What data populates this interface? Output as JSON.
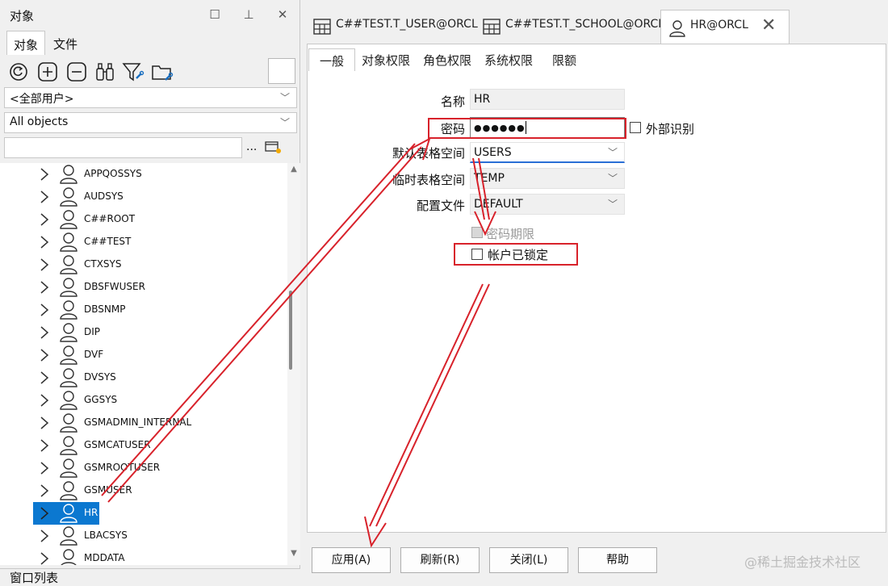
{
  "left_panel": {
    "title": "对象",
    "subtabs": [
      "对象",
      "文件"
    ],
    "user_filter": "<全部用户>",
    "object_filter": "All objects",
    "search": {
      "value": "",
      "options_label": "..."
    },
    "tree": [
      {
        "label": "APPQOSSYS"
      },
      {
        "label": "AUDSYS"
      },
      {
        "label": "C##ROOT"
      },
      {
        "label": "C##TEST"
      },
      {
        "label": "CTXSYS"
      },
      {
        "label": "DBSFWUSER"
      },
      {
        "label": "DBSNMP"
      },
      {
        "label": "DIP"
      },
      {
        "label": "DVF"
      },
      {
        "label": "DVSYS"
      },
      {
        "label": "GGSYS"
      },
      {
        "label": "GSMADMIN_INTERNAL"
      },
      {
        "label": "GSMCATUSER"
      },
      {
        "label": "GSMROOTUSER"
      },
      {
        "label": "GSMUSER"
      },
      {
        "label": "HR",
        "selected": true
      },
      {
        "label": "LBACSYS"
      },
      {
        "label": "MDDATA"
      }
    ],
    "bottom_panel_title": "窗口列表"
  },
  "doc_tabs": [
    {
      "label": "C##TEST.T_USER@ORCL",
      "icon": "table-icon"
    },
    {
      "label": "C##TEST.T_SCHOOL@ORCL",
      "icon": "table-icon"
    },
    {
      "label": "HR@ORCL",
      "icon": "user-icon",
      "active": true
    }
  ],
  "page_tabs": [
    "一般",
    "对象权限",
    "角色权限",
    "系统权限",
    "限额"
  ],
  "form": {
    "name_label": "名称",
    "name_value": "HR",
    "password_label": "密码",
    "password_value": "●●●●●●",
    "external_label": "外部识别",
    "default_ts_label": "默认表格空间",
    "default_ts_value": "USERS",
    "temp_ts_label": "临时表格空间",
    "temp_ts_value": "TEMP",
    "profile_label": "配置文件",
    "profile_value": "DEFAULT",
    "pw_expire_label": "密码期限",
    "locked_label": "帐户已锁定"
  },
  "buttons": {
    "apply": "应用(A)",
    "refresh": "刷新(R)",
    "close": "关闭(L)",
    "help": "帮助"
  },
  "watermark": "@稀土掘金技术社区",
  "colors": {
    "selection": "#0b78d0",
    "annotation": "#d8222b"
  }
}
